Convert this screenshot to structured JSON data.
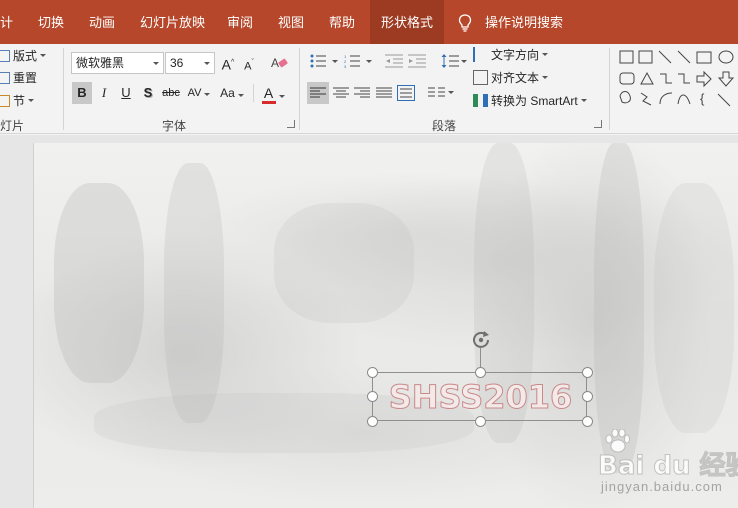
{
  "tabs": [
    {
      "label": "计",
      "active": false
    },
    {
      "label": "切换",
      "active": false
    },
    {
      "label": "动画",
      "active": false
    },
    {
      "label": "幻灯片放映",
      "active": false
    },
    {
      "label": "审阅",
      "active": false
    },
    {
      "label": "视图",
      "active": false
    },
    {
      "label": "帮助",
      "active": false
    },
    {
      "label": "形状格式",
      "active": true
    }
  ],
  "tell_me": {
    "label": "操作说明搜索",
    "icon": "lightbulb-icon"
  },
  "slides_group": {
    "layout_label": "版式",
    "reset_label": "重置",
    "section_label": "节",
    "group_label": "灯片"
  },
  "font_group": {
    "font_name": "微软雅黑",
    "font_size": "36",
    "bold": "B",
    "italic": "I",
    "underline": "U",
    "shadow": "S",
    "strikethrough": "abc",
    "spacing": "AV",
    "change_case": "Aa",
    "font_color_letter": "A",
    "grow_font": "A",
    "shrink_font": "A",
    "group_label": "字体",
    "font_color": "#d82c2c"
  },
  "paragraph_group": {
    "text_direction_label": "文字方向",
    "align_text_label": "对齐文本",
    "smartart_label": "转换为 SmartArt",
    "group_label": "段落"
  },
  "slide": {
    "text": "SHSS2016",
    "watermark_text": "Bai du 经验",
    "watermark_url": "jingyan.baidu.com"
  }
}
